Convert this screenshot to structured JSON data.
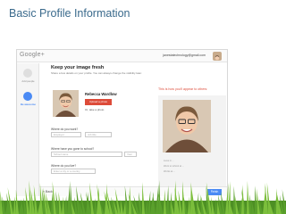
{
  "slide": {
    "title": "Basic Profile Information"
  },
  "app": {
    "logo": "Google+",
    "account_email": "janestatechnology@gmail.com"
  },
  "steps": [
    {
      "label": "Add people"
    },
    {
      "label": "Be awesome"
    }
  ],
  "main": {
    "heading": "Keep your image fresh",
    "subheading": "Share a few details on your profile. You can always change the visibility later.",
    "user_name": "Rebecca Wardlow",
    "upload_button": "Upload a photo",
    "webcam_link": "Or, take a photo",
    "preview_note": "This is how you'll appear to others:"
  },
  "questions": {
    "work_label": "Where do you work?",
    "employer_placeholder": "Employer",
    "job_title_placeholder": "Job title",
    "school_label": "Where have you gone to school?",
    "school_placeholder": "School name",
    "year_placeholder": "Year",
    "live_label": "Where do you live?",
    "city_placeholder": "Enter a city or a country"
  },
  "preview": {
    "lines": [
      "Lives in ...",
      "Went to school at ...",
      "Works at ..."
    ]
  },
  "footer": {
    "back_label": "« Back",
    "next_label": "Finish"
  },
  "colors": {
    "title": "#3a6a8c",
    "accent_blue": "#4a8af4",
    "accent_red": "#dd4b39",
    "grass": "#5aa02c"
  }
}
